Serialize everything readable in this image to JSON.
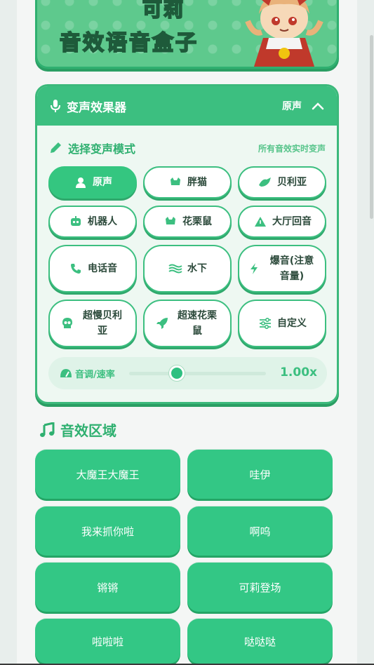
{
  "banner": {
    "title_top": "可莉",
    "title": "音效语音盒子"
  },
  "voice_changer": {
    "title": "变声效果器",
    "current_mode": "原声",
    "section_title": "选择变声模式",
    "hint": "所有音效实时变声",
    "modes": [
      {
        "label": "原声",
        "icon": "user-icon",
        "active": true
      },
      {
        "label": "胖猫",
        "icon": "cat-icon",
        "active": false
      },
      {
        "label": "贝利亚",
        "icon": "dragon-icon",
        "active": false
      },
      {
        "label": "机器人",
        "icon": "robot-icon",
        "active": false
      },
      {
        "label": "花栗鼠",
        "icon": "chipmunk-icon",
        "active": false
      },
      {
        "label": "大厅回音",
        "icon": "warning-triangle-icon",
        "active": false
      },
      {
        "label": "电话音",
        "icon": "phone-icon",
        "active": false
      },
      {
        "label": "水下",
        "icon": "water-icon",
        "active": false
      },
      {
        "label": "爆音(注意音量)",
        "icon": "bolt-icon",
        "active": false
      },
      {
        "label": "超慢贝利亚",
        "icon": "skull-icon",
        "active": false
      },
      {
        "label": "超速花栗鼠",
        "icon": "rocket-icon",
        "active": false
      },
      {
        "label": "自定义",
        "icon": "sliders-icon",
        "active": false
      }
    ],
    "pitch": {
      "label": "音调/速率",
      "value_text": "1.00x",
      "slider_fraction": 0.35
    }
  },
  "sound_effects": {
    "title": "音效区域",
    "items": [
      "大魔王大魔王",
      "哇伊",
      "我来抓你啦",
      "啊呜",
      "锵锵",
      "可莉登场",
      "啦啦啦",
      "哒哒哒"
    ]
  },
  "colors": {
    "accent": "#3cbf80",
    "accent_dark": "#2fb070",
    "button": "#33c785"
  }
}
